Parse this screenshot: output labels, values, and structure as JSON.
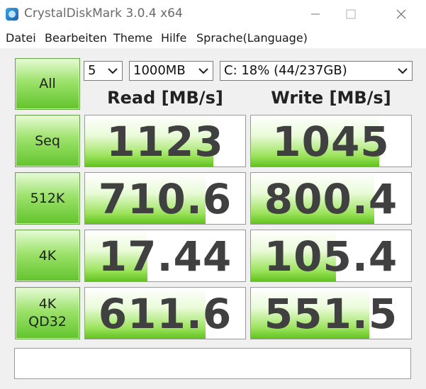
{
  "window": {
    "title": "CrystalDiskMark 3.0.4 x64"
  },
  "menu": [
    "Datei",
    "Bearbeiten",
    "Theme",
    "Hilfe",
    "Sprache(Language)"
  ],
  "controls": {
    "count": "5",
    "size": "1000MB",
    "drive": "C: 18% (44/237GB)"
  },
  "buttons": {
    "all": "All",
    "seq": "Seq",
    "k512": "512K",
    "k4": "4K",
    "qd32_line1": "4K",
    "qd32_line2": "QD32"
  },
  "headers": {
    "read": "Read [MB/s]",
    "write": "Write [MB/s]"
  },
  "results": [
    {
      "test": "Seq",
      "read": "1123",
      "write": "1045",
      "read_fill": 0.8,
      "write_fill": 0.8
    },
    {
      "test": "512K",
      "read": "710.6",
      "write": "800.4",
      "read_fill": 0.75,
      "write_fill": 0.77
    },
    {
      "test": "4K",
      "read": "17.44",
      "write": "105.4",
      "read_fill": 0.39,
      "write_fill": 0.53
    },
    {
      "test": "4K QD32",
      "read": "611.6",
      "write": "551.5",
      "read_fill": 0.75,
      "write_fill": 0.74
    }
  ],
  "status_text": "",
  "colors": {
    "bar_green": "#61c21e",
    "button_green": "#62c42b",
    "value_text": "#404040"
  }
}
